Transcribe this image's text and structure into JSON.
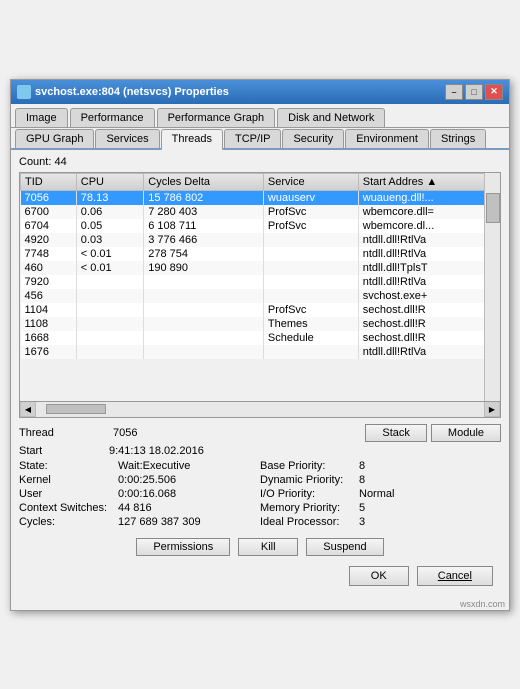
{
  "titleBar": {
    "title": "svchost.exe:804 (netsvcs) Properties",
    "minimizeLabel": "–",
    "maximizeLabel": "□",
    "closeLabel": "✕"
  },
  "tabs1": {
    "items": [
      {
        "label": "Image",
        "active": false
      },
      {
        "label": "Performance",
        "active": false
      },
      {
        "label": "Performance Graph",
        "active": false
      },
      {
        "label": "Disk and Network",
        "active": false
      }
    ]
  },
  "tabs2": {
    "items": [
      {
        "label": "GPU Graph",
        "active": false
      },
      {
        "label": "Services",
        "active": false
      },
      {
        "label": "Threads",
        "active": true
      },
      {
        "label": "TCP/IP",
        "active": false
      },
      {
        "label": "Security",
        "active": false
      },
      {
        "label": "Environment",
        "active": false
      },
      {
        "label": "Strings",
        "active": false
      }
    ]
  },
  "countLabel": "Count:",
  "countValue": "44",
  "tableHeaders": [
    "TID",
    "CPU",
    "Cycles Delta",
    "Service",
    "Start Address"
  ],
  "tableRows": [
    {
      "tid": "7056",
      "cpu": "78.13",
      "cyclesDelta": "15 786 802",
      "service": "wuauserv",
      "startAddress": "wuaueng.dll!...",
      "selected": true
    },
    {
      "tid": "6700",
      "cpu": "0.06",
      "cyclesDelta": "7 280 403",
      "service": "ProfSvc",
      "startAddress": "wbemcore.dll="
    },
    {
      "tid": "6704",
      "cpu": "0.05",
      "cyclesDelta": "6 108 711",
      "service": "ProfSvc",
      "startAddress": "wbemcore.dl..."
    },
    {
      "tid": "4920",
      "cpu": "0.03",
      "cyclesDelta": "3 776 466",
      "service": "",
      "startAddress": "ntdll.dll!RtlVa"
    },
    {
      "tid": "7748",
      "cpu": "< 0.01",
      "cyclesDelta": "278 754",
      "service": "",
      "startAddress": "ntdll.dll!RtlVa"
    },
    {
      "tid": "460",
      "cpu": "< 0.01",
      "cyclesDelta": "190 890",
      "service": "",
      "startAddress": "ntdll.dll!TplsT"
    },
    {
      "tid": "7920",
      "cpu": "",
      "cyclesDelta": "",
      "service": "",
      "startAddress": "ntdll.dll!RtlVa"
    },
    {
      "tid": "456",
      "cpu": "",
      "cyclesDelta": "",
      "service": "",
      "startAddress": "svchost.exe+"
    },
    {
      "tid": "1104",
      "cpu": "",
      "cyclesDelta": "",
      "service": "ProfSvc",
      "startAddress": "sechost.dll!R"
    },
    {
      "tid": "1108",
      "cpu": "",
      "cyclesDelta": "",
      "service": "Themes",
      "startAddress": "sechost.dll!R"
    },
    {
      "tid": "1668",
      "cpu": "",
      "cyclesDelta": "",
      "service": "Schedule",
      "startAddress": "sechost.dll!R"
    },
    {
      "tid": "1676",
      "cpu": "",
      "cyclesDelta": "",
      "service": "",
      "startAddress": "ntdll.dll!RtlVa"
    }
  ],
  "infoSection": {
    "threadLabel": "Thread",
    "threadValue": "7056",
    "stackLabel": "Stack",
    "moduleLabel": "Module",
    "startLabel": "Start",
    "startValue": "9:41:13   18.02.2016",
    "stateLabel": "State:",
    "stateValue": "Wait:Executive",
    "basePriorityLabel": "Base Priority:",
    "basePriorityValue": "8",
    "kernelLabel": "Kernel",
    "kernelValue": "0:00:25.506",
    "dynamicPriorityLabel": "Dynamic Priority:",
    "dynamicPriorityValue": "8",
    "userLabel": "User",
    "userValue": "0:00:16.068",
    "ioPriorityLabel": "I/O Priority:",
    "ioPriorityValue": "Normal",
    "contextSwitchesLabel": "Context Switches:",
    "contextSwitchesValue": "44 816",
    "memoryPriorityLabel": "Memory Priority:",
    "memoryPriorityValue": "5",
    "cyclesLabel": "Cycles:",
    "cyclesValue": "127 689 387 309",
    "idealProcessorLabel": "Ideal Processor:",
    "idealProcessorValue": "3"
  },
  "bottomButtons": {
    "permissionsLabel": "Permissions",
    "killLabel": "Kill",
    "suspendLabel": "Suspend"
  },
  "actionButtons": {
    "okLabel": "OK",
    "cancelLabel": "Cancel"
  },
  "watermark": "wsxdn.com"
}
